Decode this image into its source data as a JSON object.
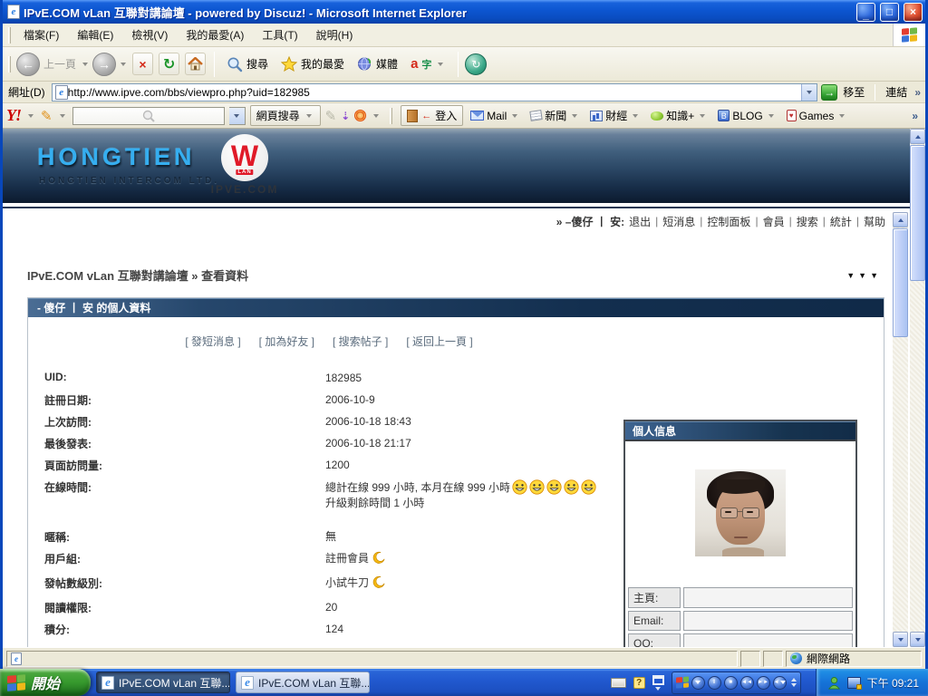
{
  "window": {
    "title": "IPvE.COM vLan 互聯對講論壇 - powered by Discuz! - Microsoft Internet Explorer"
  },
  "icons": {
    "minimize": "_",
    "maximize": "□",
    "close": "×",
    "ie": "e",
    "back_arrow": "←",
    "forward_arrow": "→",
    "stop": "×",
    "refresh": "↻",
    "go_arrow": "→",
    "chevron": "»",
    "pipe": "|",
    "pencil": "✎",
    "question": "?",
    "person": "☻",
    "pause": "‖",
    "stop_sq": "■",
    "prev": "◄◄",
    "next": "►►",
    "vol": "◄"
  },
  "menu": {
    "items": [
      "檔案(F)",
      "編輯(E)",
      "檢視(V)",
      "我的最愛(A)",
      "工具(T)",
      "說明(H)"
    ]
  },
  "toolbar": {
    "back": "上一頁",
    "search": "搜尋",
    "favorites": "我的最愛",
    "media": "媒體",
    "enc_a": "a",
    "enc_b": "字"
  },
  "address": {
    "label": "網址(D)",
    "url": "http://www.ipve.com/bbs/viewpro.php?uid=182985",
    "go": "移至",
    "links": "連結"
  },
  "yahoo": {
    "logo": "Y!",
    "search_button": "網頁搜尋",
    "login": "登入",
    "menus": [
      "Mail",
      "新聞",
      "財經",
      "知識+",
      "BLOG",
      "Games"
    ],
    "blog_glyph": "B",
    "game_glyph": "♥"
  },
  "banner": {
    "brand": "HONGTIEN",
    "brand_sub": "HONGTIEN INTERCOM LTD.",
    "logo_letter": "W",
    "logo_lan": "LAN",
    "logo_site": "IPVE.COM"
  },
  "usernav": {
    "user": "» –傻仔 丨 安:",
    "links": [
      "退出",
      "短消息",
      "控制面板",
      "會員",
      "搜索",
      "統計",
      "幫助"
    ]
  },
  "breadcrumb": {
    "text": "IPvE.COM vLan 互聯對講論壇 » 查看資料",
    "arrows": "▼▼▼"
  },
  "profile": {
    "title": "- 傻仔 丨 安 的個人資料",
    "actions": [
      "[ 發短消息 ]",
      "[ 加為好友 ]",
      "[ 搜索帖子 ]",
      "[ 返回上一頁 ]"
    ],
    "fields": [
      {
        "label": "UID:",
        "value": "182985"
      },
      {
        "label": "註冊日期:",
        "value": "2006-10-9"
      },
      {
        "label": "上次訪問:",
        "value": "2006-10-18 18:43"
      },
      {
        "label": "最後發表:",
        "value": "2006-10-18 21:17"
      },
      {
        "label": "頁面訪問量:",
        "value": "1200"
      }
    ],
    "online": {
      "label": "在線時間:",
      "line1": "總計在線 999 小時, 本月在線 999 小時",
      "line2": "升級剩餘時間 1 小時"
    },
    "fields2": [
      {
        "label": "暱稱:",
        "value": "無"
      },
      {
        "label": "用戶組:",
        "value": "註冊會員"
      },
      {
        "label": "發帖數級別:",
        "value": "小試牛刀"
      },
      {
        "label": "閱讀權限:",
        "value": "20"
      },
      {
        "label": "積分:",
        "value": "124"
      }
    ]
  },
  "info_panel": {
    "title": "個人信息",
    "rows": [
      {
        "label": "主頁:",
        "value": ""
      },
      {
        "label": "Email:",
        "value": ""
      },
      {
        "label": "QQ:",
        "value": ""
      }
    ]
  },
  "statusbar": {
    "zone": "網際網路"
  },
  "taskbar": {
    "start": "開始",
    "tasks": [
      "IPvE.COM vLan 互聯...",
      "IPvE.COM vLan 互聯..."
    ],
    "time": "下午 09:21"
  }
}
